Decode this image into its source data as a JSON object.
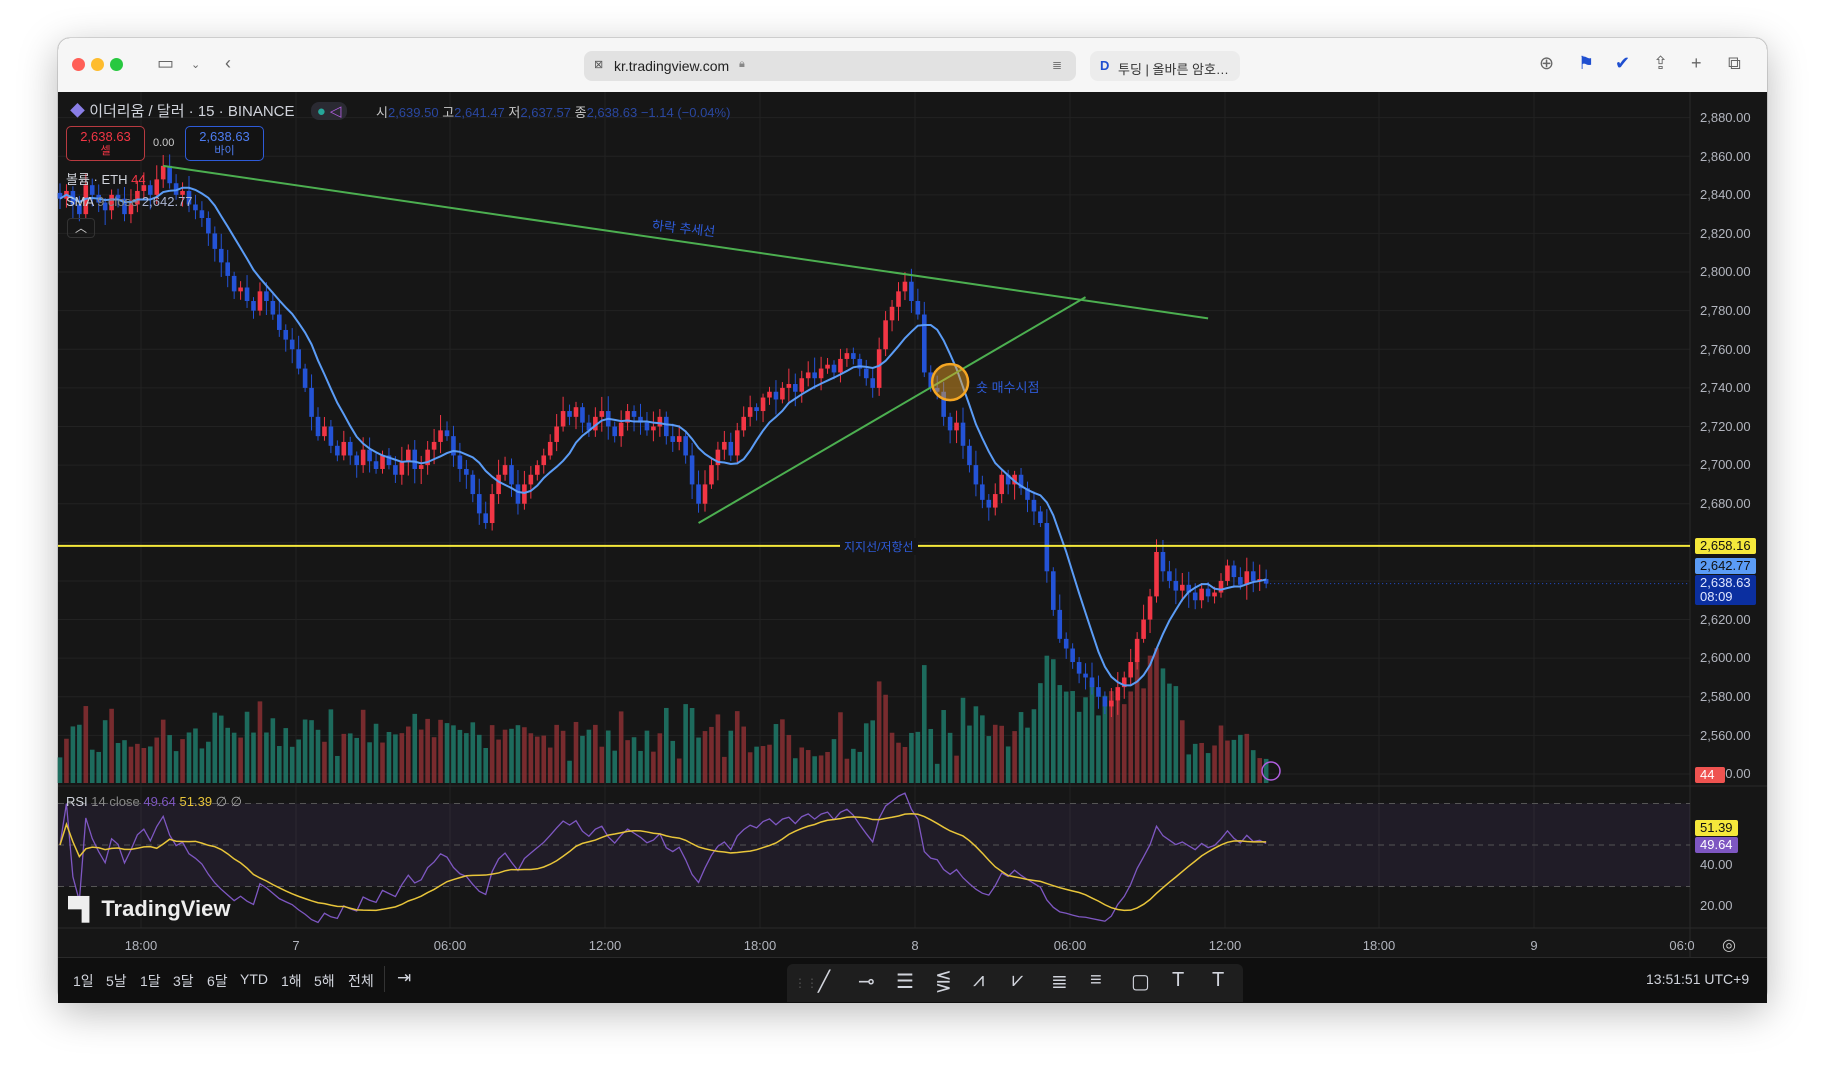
{
  "browser": {
    "url": "kr.tradingview.com",
    "second_tab": "투딩 | 올바른 암호…",
    "icons": [
      "sidebar-icon",
      "chevron-down-icon",
      "back-icon",
      "lock-icon",
      "reader-icon",
      "download-icon",
      "extension-icon",
      "check-icon",
      "share-icon",
      "plus-icon",
      "tabs-icon"
    ]
  },
  "header": {
    "symbol": "이더리움 / 달러 · 15 · BINANCE",
    "ohlc": {
      "o_label": "시",
      "o": "2,639.50",
      "h_label": "고",
      "h": "2,641.47",
      "l_label": "저",
      "l": "2,637.57",
      "c_label": "종",
      "c": "2,638.63",
      "change": "−1.14 (−0.04%)"
    },
    "sell": {
      "price": "2,638.63",
      "label": "셀"
    },
    "spread": "0.00",
    "buy": {
      "price": "2,638.63",
      "label": "바이"
    },
    "volume_legend": {
      "name": "볼륨 · ETH",
      "value": "44"
    },
    "sma_legend": {
      "name": "SMA",
      "params": "9 close",
      "value": "2,642.77"
    },
    "rsi_legend": {
      "name": "RSI",
      "params": "14 close",
      "value": "49.64",
      "ma_value": "51.39",
      "extra": "∅ ∅"
    }
  },
  "price_axis": [
    "2,880.00",
    "2,860.00",
    "2,840.00",
    "2,820.00",
    "2,800.00",
    "2,780.00",
    "2,760.00",
    "2,740.00",
    "2,720.00",
    "2,700.00",
    "2,680.00",
    "2,660.00",
    "2,640.00",
    "2,620.00",
    "2,600.00",
    "2,580.00",
    "2,560.00",
    "2,540.00"
  ],
  "rsi_axis": [
    "40.00",
    "20.00"
  ],
  "badges": {
    "support": "2,658.16",
    "sma": "2,642.77",
    "last": "2,638.63",
    "countdown": "08:09",
    "volume": "44",
    "rsi_ma": "51.39",
    "rsi": "49.64"
  },
  "time_axis": [
    "18:00",
    "7",
    "06:00",
    "12:00",
    "18:00",
    "8",
    "06:00",
    "12:00",
    "18:00",
    "9",
    "06:0"
  ],
  "annotations": {
    "down_trend": "하락 추세선",
    "short_entry": "숏 매수시점",
    "support_resistance": "지지선/저항선"
  },
  "logo": "TradingView",
  "ranges": [
    "1일",
    "5날",
    "1달",
    "3달",
    "6달",
    "YTD",
    "1해",
    "5해",
    "전체"
  ],
  "clock": "13:51:51 UTC+9",
  "colors": {
    "up": "#f23645",
    "down": "#2453d6",
    "sma": "#5b9cf6",
    "trend": "#4caf50",
    "support": "#f5e83b",
    "rsi": "#7e57c2",
    "rsi_ma": "#e8c53a",
    "circle": "#f5a623"
  },
  "chart_data": {
    "type": "candlestick",
    "interval": "15",
    "price_range": [
      2540,
      2880
    ],
    "closes": [
      2838,
      2842,
      2835,
      2830,
      2845,
      2840,
      2836,
      2832,
      2840,
      2838,
      2830,
      2835,
      2842,
      2845,
      2840,
      2848,
      2855,
      2846,
      2840,
      2842,
      2835,
      2832,
      2828,
      2820,
      2812,
      2805,
      2798,
      2790,
      2792,
      2785,
      2780,
      2790,
      2785,
      2778,
      2770,
      2765,
      2760,
      2750,
      2740,
      2725,
      2715,
      2720,
      2710,
      2705,
      2712,
      2705,
      2700,
      2708,
      2702,
      2698,
      2705,
      2700,
      2695,
      2702,
      2708,
      2698,
      2700,
      2708,
      2712,
      2718,
      2715,
      2705,
      2698,
      2695,
      2685,
      2675,
      2670,
      2685,
      2695,
      2700,
      2690,
      2680,
      2690,
      2695,
      2700,
      2705,
      2712,
      2720,
      2728,
      2725,
      2730,
      2722,
      2718,
      2725,
      2728,
      2720,
      2715,
      2722,
      2728,
      2725,
      2722,
      2718,
      2720,
      2725,
      2715,
      2712,
      2715,
      2705,
      2690,
      2680,
      2690,
      2700,
      2708,
      2712,
      2705,
      2718,
      2725,
      2730,
      2728,
      2735,
      2738,
      2734,
      2740,
      2742,
      2738,
      2745,
      2748,
      2745,
      2750,
      2752,
      2748,
      2755,
      2758,
      2755,
      2750,
      2745,
      2740,
      2760,
      2775,
      2782,
      2790,
      2795,
      2785,
      2778,
      2748,
      2740,
      2738,
      2725,
      2718,
      2722,
      2710,
      2700,
      2690,
      2682,
      2678,
      2685,
      2695,
      2690,
      2695,
      2688,
      2682,
      2676,
      2670,
      2645,
      2625,
      2610,
      2605,
      2598,
      2592,
      2590,
      2585,
      2580,
      2575,
      2578,
      2585,
      2590,
      2598,
      2610,
      2620,
      2632,
      2655,
      2645,
      2640,
      2635,
      2638,
      2634,
      2630,
      2636,
      2632,
      2634,
      2640,
      2648,
      2642,
      2638,
      2645,
      2640,
      2641,
      2638.63
    ],
    "support_level": 2658.16,
    "down_trendline": [
      [
        16,
        2855
      ],
      [
        178,
        2776
      ]
    ],
    "up_trendline": [
      [
        99,
        2670
      ],
      [
        159,
        2787
      ]
    ],
    "marker_circle": [
      138,
      2743
    ]
  }
}
